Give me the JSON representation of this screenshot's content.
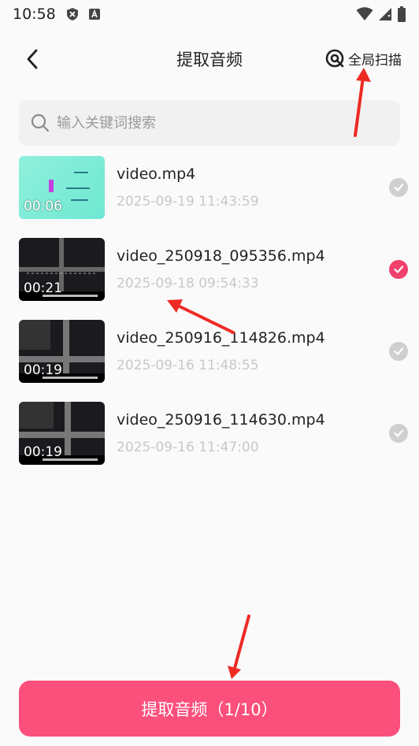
{
  "status_bar": {
    "time": "10:58"
  },
  "header": {
    "title": "提取音频",
    "scan_label": "全局扫描"
  },
  "search": {
    "placeholder": "输入关键词搜索"
  },
  "files": [
    {
      "name": "video.mp4",
      "datetime": "2025-09-19  11:43:59",
      "duration": "00:06",
      "selected": false,
      "thumb": "cyan"
    },
    {
      "name": "video_250918_095356.mp4",
      "datetime": "2025-09-18  09:54:33",
      "duration": "00:21",
      "selected": true,
      "thumb": "dark"
    },
    {
      "name": "video_250916_114826.mp4",
      "datetime": "2025-09-16  11:48:55",
      "duration": "00:19",
      "selected": false,
      "thumb": "dark"
    },
    {
      "name": "video_250916_114630.mp4",
      "datetime": "2025-09-16  11:47:00",
      "duration": "00:19",
      "selected": false,
      "thumb": "dark"
    }
  ],
  "extract_button": {
    "label": "提取音频（1/10）"
  },
  "colors": {
    "accent": "#fb4f7c",
    "check_selected": "#f0406c",
    "check_unselected": "#cfcfcf",
    "arrow": "#ee2a24"
  }
}
